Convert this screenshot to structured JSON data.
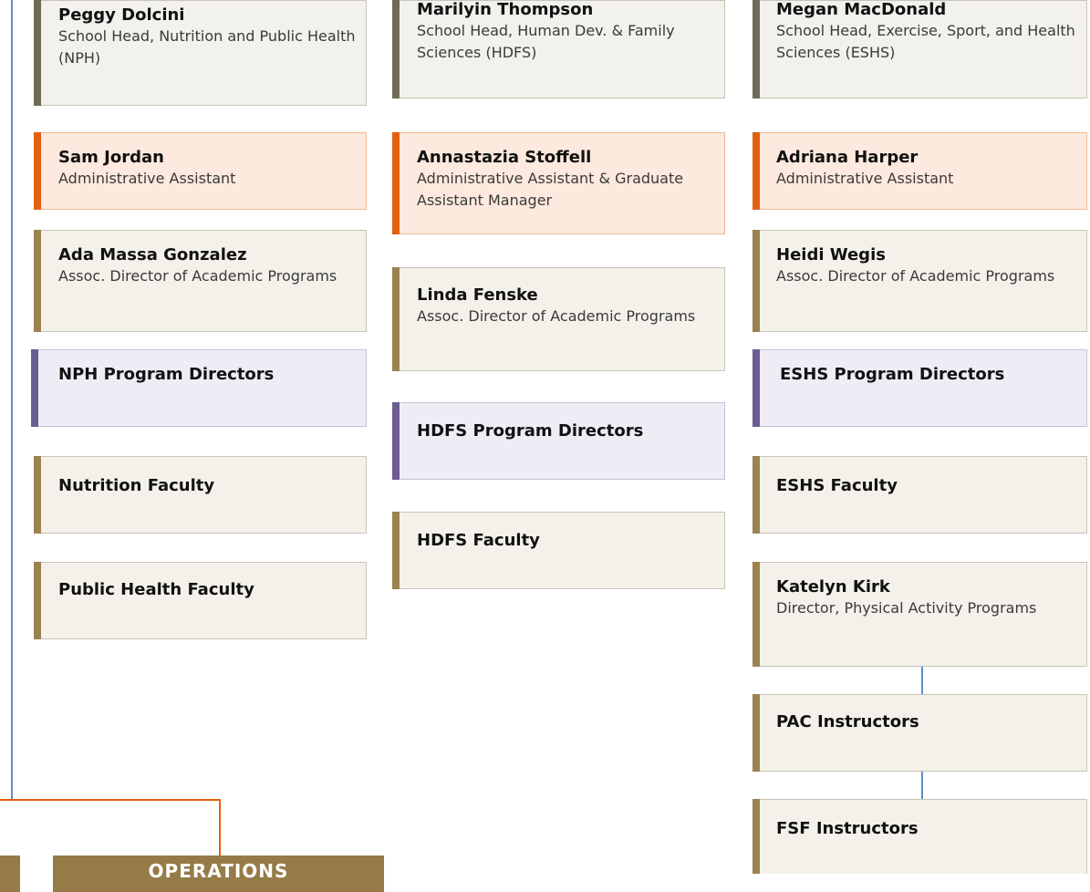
{
  "columns": {
    "nph": {
      "head": {
        "name": "Peggy Dolcini",
        "role": "School Head, Nutrition and Public Health (NPH)"
      },
      "assistant": {
        "name": "Sam Jordan",
        "role": "Administrative Assistant"
      },
      "assoc": {
        "name": "Ada Massa Gonzalez",
        "role": "Assoc. Director of Academic Programs"
      },
      "program_directors": "NPH Program Directors",
      "faculty_1": "Nutrition Faculty",
      "faculty_2": "Public Health Faculty"
    },
    "hdfs": {
      "head": {
        "name": "Marilyin Thompson",
        "role": "School Head, Human Dev. & Family Sciences (HDFS)"
      },
      "assistant": {
        "name": "Annastazia Stoffell",
        "role": "Administrative Assistant & Graduate Assistant Manager"
      },
      "assoc": {
        "name": "Linda Fenske",
        "role": "Assoc. Director of Academic Programs"
      },
      "program_directors": "HDFS Program Directors",
      "faculty": "HDFS Faculty"
    },
    "eshs": {
      "head": {
        "name": "Megan MacDonald",
        "role": "School Head, Exercise, Sport, and Health Sciences (ESHS)"
      },
      "assistant": {
        "name": "Adriana Harper",
        "role": "Administrative Assistant"
      },
      "assoc": {
        "name": "Heidi Wegis",
        "role": "Assoc. Director of Academic Programs"
      },
      "program_directors": "ESHS Program Directors",
      "faculty": "ESHS Faculty",
      "pa_director": {
        "name": "Katelyn Kirk",
        "role": "Director, Physical Activity Programs"
      },
      "pac_instructors": "PAC Instructors",
      "fsf_instructors": "FSF Instructors"
    }
  },
  "operations": {
    "label": "OPERATIONS"
  }
}
